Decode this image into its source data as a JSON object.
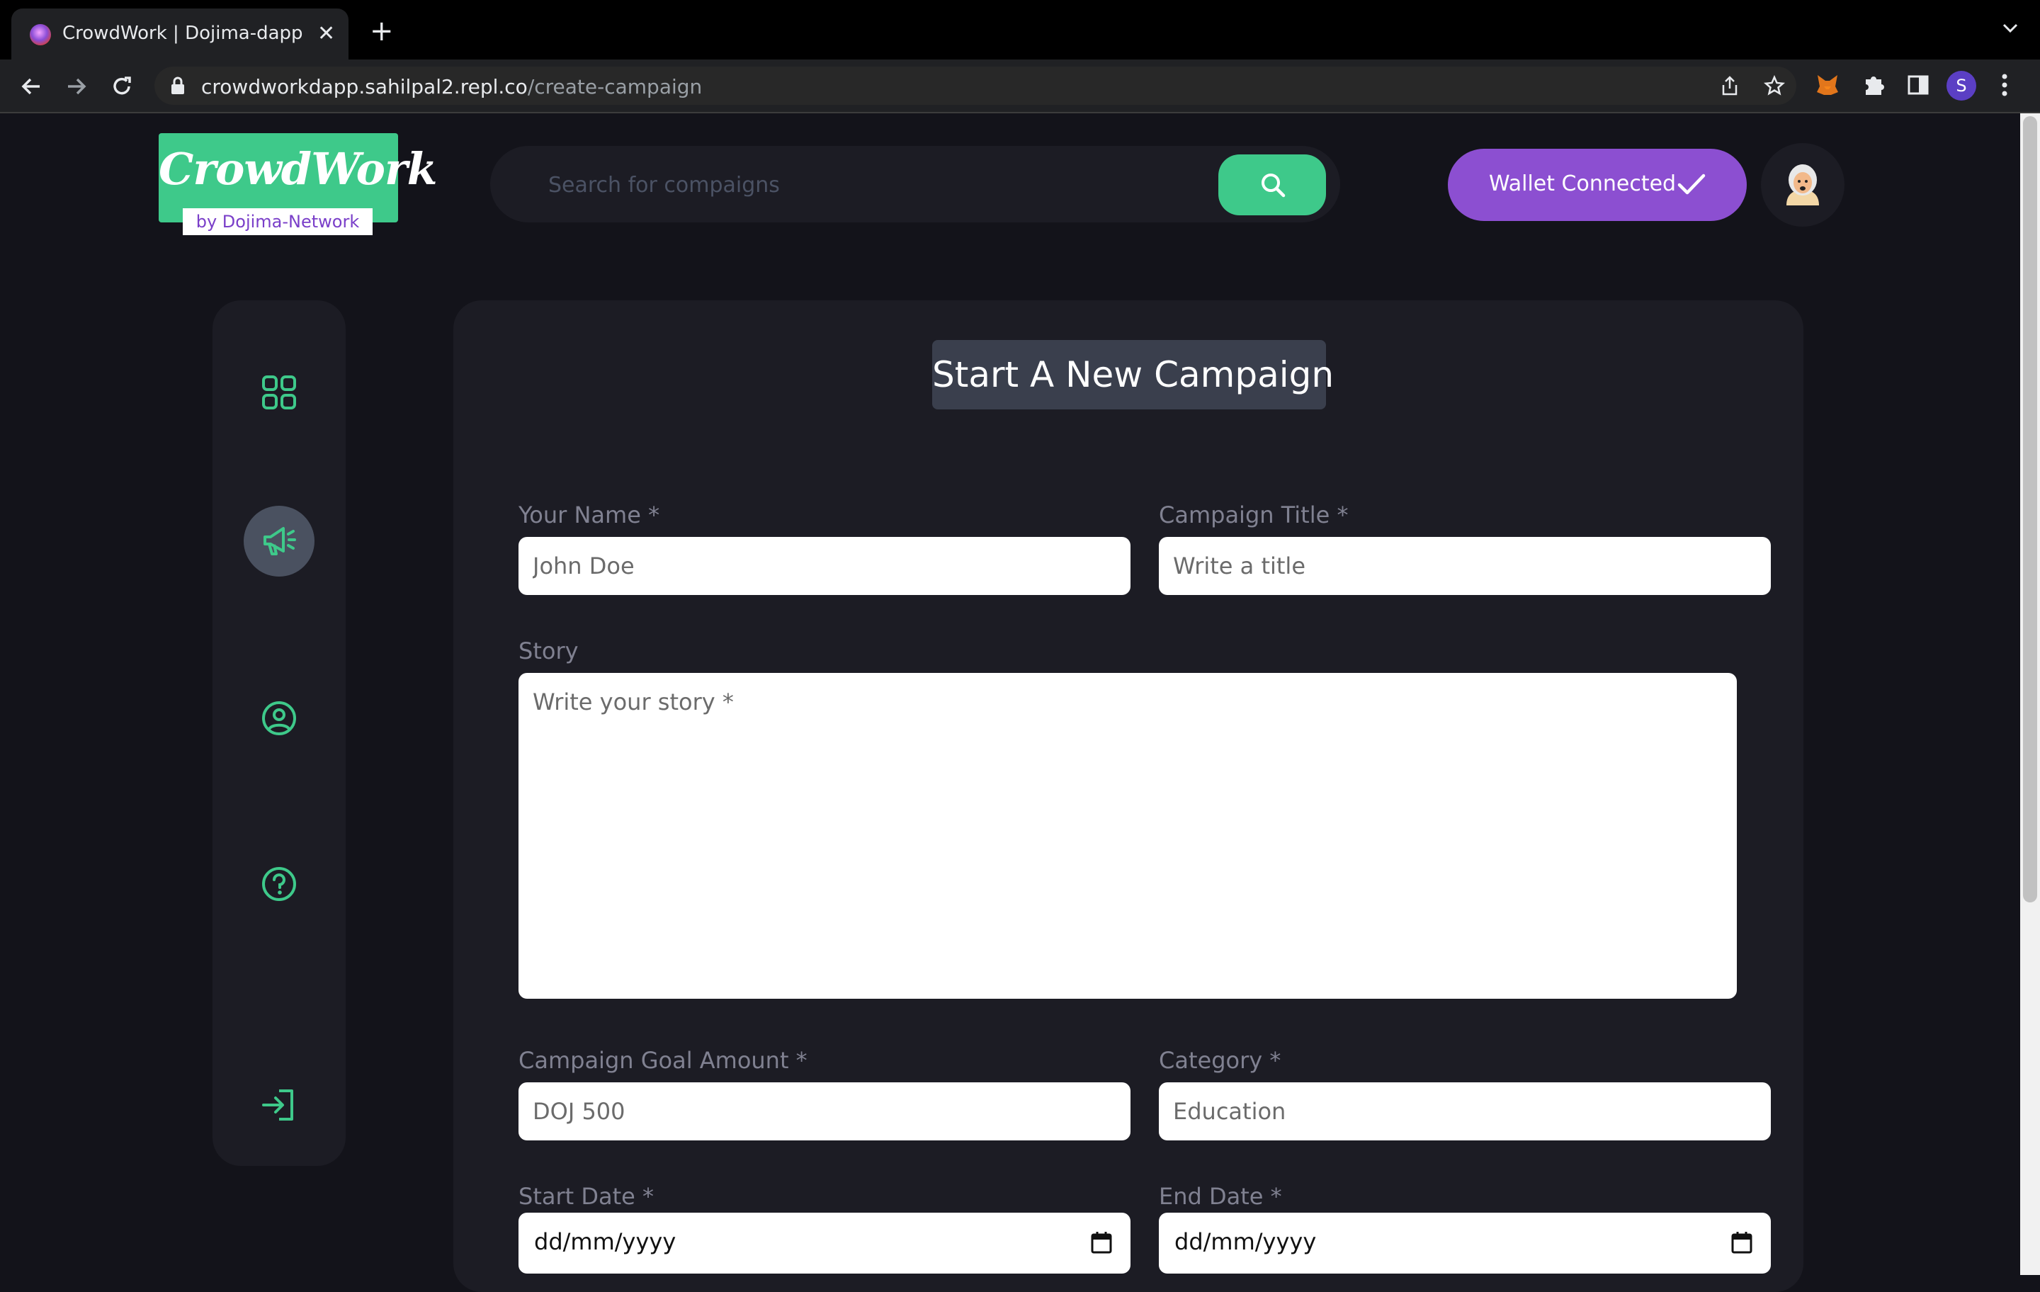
{
  "browser": {
    "tab_title": "CrowdWork | Dojima-dapp",
    "url_host": "crowdworkdapp.sahilpal2.repl.co",
    "url_path": "/create-campaign",
    "profile_initial": "S"
  },
  "header": {
    "logo_text": "CrowdWork",
    "logo_sub": "by Dojima-Network",
    "search_placeholder": "Search for compaigns",
    "wallet_label": "Wallet Connected"
  },
  "sidebar": {
    "items": [
      {
        "icon": "dashboard-grid-icon",
        "active": false
      },
      {
        "icon": "megaphone-icon",
        "active": true
      },
      {
        "icon": "profile-icon",
        "active": false
      },
      {
        "icon": "help-icon",
        "active": false
      },
      {
        "icon": "logout-icon",
        "active": false
      }
    ]
  },
  "form": {
    "title": "Start A New Campaign",
    "name": {
      "label": "Your Name *",
      "placeholder": "John Doe"
    },
    "campaign_title": {
      "label": "Campaign Title *",
      "placeholder": "Write a title"
    },
    "story": {
      "label": "Story",
      "placeholder": "Write your story *"
    },
    "goal": {
      "label": "Campaign Goal Amount *",
      "placeholder": "DOJ 500"
    },
    "category": {
      "label": "Category *",
      "placeholder": "Education"
    },
    "start_date": {
      "label": "Start Date *",
      "placeholder": "dd/mm/yyyy"
    },
    "end_date": {
      "label": "End Date *",
      "placeholder": "dd/mm/yyyy"
    }
  },
  "colors": {
    "accent_green": "#3ec98a",
    "accent_purple": "#8c4fd1",
    "background": "#13131a",
    "card": "#1c1c24"
  }
}
